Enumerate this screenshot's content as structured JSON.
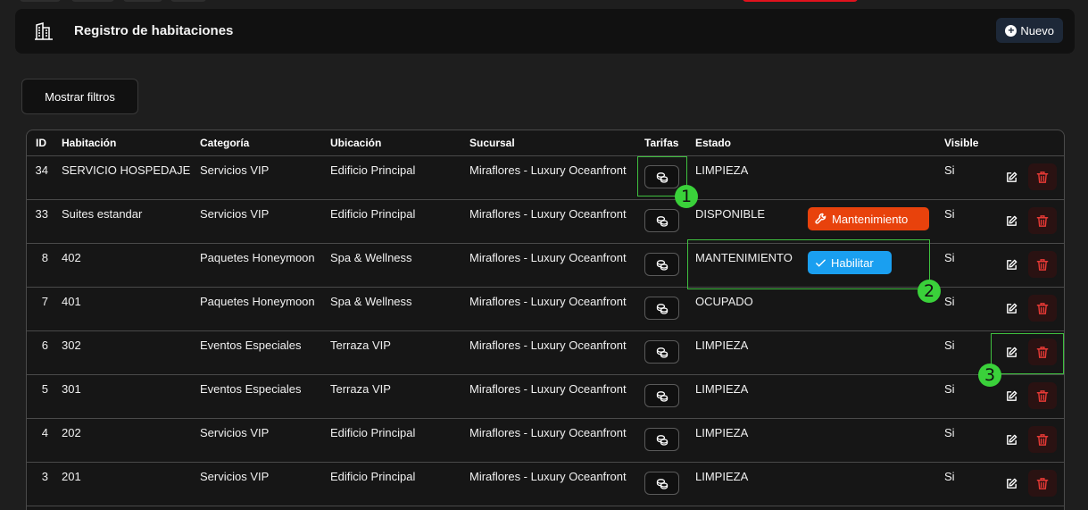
{
  "header": {
    "title": "Registro de habitaciones",
    "new_button": "Nuevo",
    "icon": "building-icon"
  },
  "filters": {
    "show_label": "Mostrar filtros"
  },
  "table": {
    "columns": [
      "ID",
      "Habitación",
      "Categoría",
      "Ubicación",
      "Sucursal",
      "Tarifas",
      "Estado",
      "Visible"
    ],
    "rows": [
      {
        "id": "34",
        "habitacion": "SERVICIO HOSPEDAJE",
        "categoria": "Servicios VIP",
        "ubicacion": "Edificio Principal",
        "sucursal": "Miraflores - Luxury Oceanfront",
        "estado": "LIMPIEZA",
        "visible": "Si"
      },
      {
        "id": "33",
        "habitacion": "Suites estandar",
        "categoria": "Servicios VIP",
        "ubicacion": "Edificio Principal",
        "sucursal": "Miraflores - Luxury Oceanfront",
        "estado": "DISPONIBLE",
        "visible": "Si",
        "action": "Mantenimiento"
      },
      {
        "id": "8",
        "habitacion": "402",
        "categoria": "Paquetes Honeymoon",
        "ubicacion": "Spa & Wellness",
        "sucursal": "Miraflores - Luxury Oceanfront",
        "estado": "MANTENIMIENTO",
        "visible": "Si",
        "action": "Habilitar"
      },
      {
        "id": "7",
        "habitacion": "401",
        "categoria": "Paquetes Honeymoon",
        "ubicacion": "Spa & Wellness",
        "sucursal": "Miraflores - Luxury Oceanfront",
        "estado": "OCUPADO",
        "visible": "Si"
      },
      {
        "id": "6",
        "habitacion": "302",
        "categoria": "Eventos Especiales",
        "ubicacion": "Terraza VIP",
        "sucursal": "Miraflores - Luxury Oceanfront",
        "estado": "LIMPIEZA",
        "visible": "Si"
      },
      {
        "id": "5",
        "habitacion": "301",
        "categoria": "Eventos Especiales",
        "ubicacion": "Terraza VIP",
        "sucursal": "Miraflores - Luxury Oceanfront",
        "estado": "LIMPIEZA",
        "visible": "Si"
      },
      {
        "id": "4",
        "habitacion": "202",
        "categoria": "Servicios VIP",
        "ubicacion": "Edificio Principal",
        "sucursal": "Miraflores - Luxury Oceanfront",
        "estado": "LIMPIEZA",
        "visible": "Si"
      },
      {
        "id": "3",
        "habitacion": "201",
        "categoria": "Servicios VIP",
        "ubicacion": "Edificio Principal",
        "sucursal": "Miraflores - Luxury Oceanfront",
        "estado": "LIMPIEZA",
        "visible": "Si"
      }
    ]
  },
  "annotations": [
    "1",
    "2",
    "3"
  ],
  "colors": {
    "mantenimiento": "#e8420c",
    "habilitar": "#1a9ff0",
    "delete": "#e53935",
    "annotation": "#3ad13a"
  }
}
